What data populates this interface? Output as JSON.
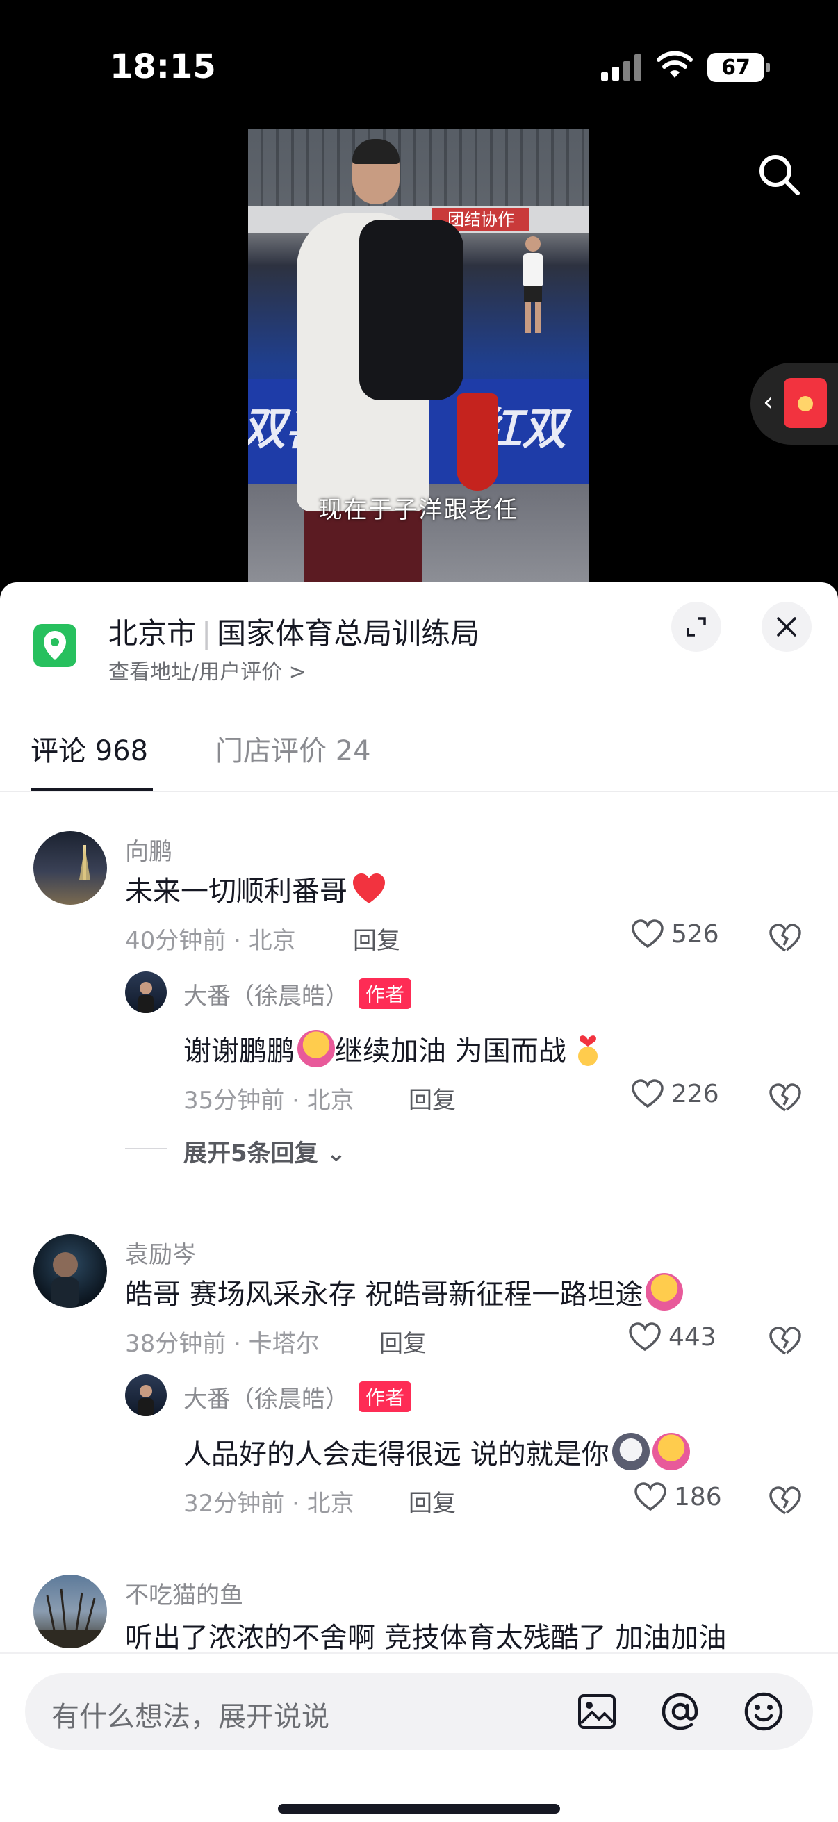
{
  "status": {
    "time": "18:15",
    "battery": "67"
  },
  "video": {
    "banner_text": "团结协作",
    "board_text_left": "双喜",
    "board_text_right": "红双",
    "subtitle": "现在于子洋跟老任"
  },
  "location": {
    "city": "北京市",
    "place": "国家体育总局训练局",
    "sub_link": "查看地址/用户评价 >"
  },
  "tabs": {
    "comments": "评论 968",
    "reviews": "门店评价 24"
  },
  "comments": [
    {
      "user": "向鹏",
      "text": "未来一切顺利番哥",
      "meta": "40分钟前 · 北京",
      "reply_label": "回复",
      "likes": "526",
      "replies": [
        {
          "user": "大番（徐晨皓）",
          "badge": "作者",
          "text": "谢谢鹏鹏",
          "text2": "继续加油 为国而战",
          "meta": "35分钟前 · 北京",
          "reply_label": "回复",
          "likes": "226"
        }
      ],
      "expand_label": "展开5条回复"
    },
    {
      "user": "袁励岑",
      "text": "皓哥 赛场风采永存 祝皓哥新征程一路坦途",
      "meta": "38分钟前 · 卡塔尔",
      "reply_label": "回复",
      "likes": "443",
      "replies": [
        {
          "user": "大番（徐晨皓）",
          "badge": "作者",
          "text": "人品好的人会走得很远 说的就是你",
          "meta": "32分钟前 · 北京",
          "reply_label": "回复",
          "likes": "186"
        }
      ]
    },
    {
      "user": "不吃猫的鱼",
      "text": "听出了浓浓的不舍啊 竞技体育太残酷了 加油加油"
    }
  ],
  "input": {
    "placeholder": "有什么想法，展开说说"
  },
  "colors": {
    "accent": "#fe2c55",
    "location_green": "#27c05e"
  }
}
